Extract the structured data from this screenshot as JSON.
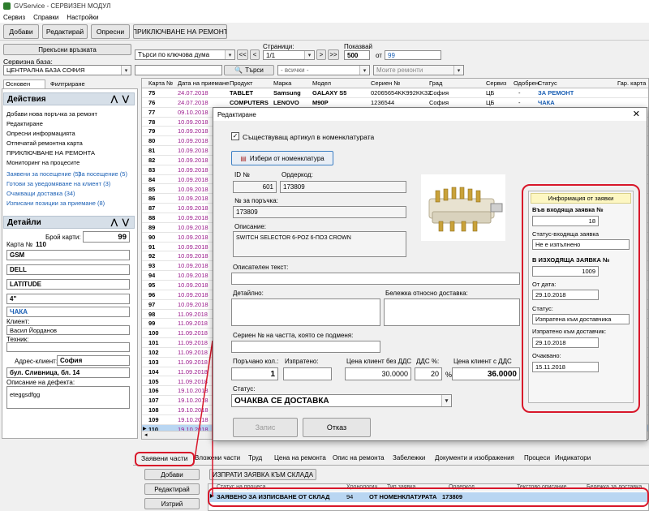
{
  "window_title": "GVService - СЕРВИЗЕН МОДУЛ",
  "menu": [
    "Сервиз",
    "Справки",
    "Настройки"
  ],
  "toolbar": {
    "add": "Добави",
    "edit": "Редактирай",
    "refresh": "Опресни",
    "close_repair": "ПРИКЛЮЧВАНЕ НА РЕМОНТ"
  },
  "connection": {
    "disconnect": "Прекъсни връзката",
    "db_label": "Сервизна база:",
    "db_value": "ЦЕНТРАЛНА БАЗА СОФИЯ"
  },
  "search": {
    "mode": "Търси по ключова дума",
    "pages_label": "Страници:",
    "page_value": "1/1",
    "shown_label": "Показвай",
    "shown_value": "500",
    "of_label": "от",
    "total_value": "99",
    "nav_first": "<<",
    "nav_prev": "<",
    "nav_next": ">",
    "nav_last": ">>",
    "search_button": "Търси",
    "filter_all": "- всички -",
    "my_repairs": "Моите ремонти"
  },
  "left_tabs": {
    "main": "Основен панел",
    "filter": "Филтриране"
  },
  "actions": {
    "title": "Действия",
    "items": [
      "Добави нова поръчка за ремонт",
      "Редактиране",
      "Опресни информацията",
      "Отпечатай ремонтна карта",
      "ПРИКЛЮЧВАНЕ НА РЕМОНТА",
      "Мониторинг на процесите"
    ],
    "links": [
      "Заявени за посещение (5)",
      "За посещение (5)",
      "Готови за уведомяване на клиент (3)",
      "Очакващи доставка (34)",
      "Изписани позиции за приемане (8)"
    ]
  },
  "details": {
    "title": "Детайли",
    "cards_label": "Брой карти:",
    "cards_value": "99",
    "card_label": "Карта №",
    "card_no": "110",
    "type": "GSM",
    "brand": "DELL",
    "model": "LATITUDE",
    "size": "4\"",
    "blank": "",
    "status": "ЧАКА",
    "client_label": "Клиент:",
    "client": "Васил Йорданов",
    "tech_label": "Техник:",
    "tech": "",
    "address_label": "Адрес-клиент:",
    "address_city": "София",
    "address": "бул. Сливница, бл. 14",
    "defect_label": "Описание на дефекта:",
    "defect": "eteggsdfgg"
  },
  "grid": {
    "headers": [
      "Карта №",
      "Дата на приемане",
      "Продукт",
      "Марка",
      "Модел",
      "Сериен №",
      "Град",
      "Сервиз",
      "Одобрен",
      "Статус",
      "Гар. карта"
    ],
    "rows": [
      {
        "no": "75",
        "date": "24.07.2018",
        "product": "TABLET",
        "brand": "Samsung",
        "model": "GALAXY S5",
        "serial": "02065654KK992KK32",
        "city": "София",
        "service": "ЦБ",
        "approved": "-",
        "status": "ЗА РЕМОНТ"
      },
      {
        "no": "76",
        "date": "24.07.2018",
        "product": "COMPUTERS",
        "brand": "LENOVO",
        "model": "M90P",
        "serial": "1236544",
        "city": "София",
        "service": "ЦБ",
        "approved": "-",
        "status": "ЧАКА"
      },
      {
        "no": "77",
        "date": "09.10.2018"
      },
      {
        "no": "78",
        "date": "10.09.2018"
      },
      {
        "no": "79",
        "date": "10.09.2018"
      },
      {
        "no": "80",
        "date": "10.09.2018"
      },
      {
        "no": "81",
        "date": "10.09.2018"
      },
      {
        "no": "82",
        "date": "10.09.2018"
      },
      {
        "no": "83",
        "date": "10.09.2018"
      },
      {
        "no": "84",
        "date": "10.09.2018"
      },
      {
        "no": "85",
        "date": "10.09.2018"
      },
      {
        "no": "86",
        "date": "10.09.2018"
      },
      {
        "no": "87",
        "date": "10.09.2018"
      },
      {
        "no": "88",
        "date": "10.09.2018"
      },
      {
        "no": "89",
        "date": "10.09.2018"
      },
      {
        "no": "90",
        "date": "10.09.2018"
      },
      {
        "no": "91",
        "date": "10.09.2018"
      },
      {
        "no": "92",
        "date": "10.09.2018"
      },
      {
        "no": "93",
        "date": "10.09.2018"
      },
      {
        "no": "94",
        "date": "10.09.2018"
      },
      {
        "no": "95",
        "date": "10.09.2018"
      },
      {
        "no": "96",
        "date": "10.09.2018"
      },
      {
        "no": "97",
        "date": "10.09.2018"
      },
      {
        "no": "98",
        "date": "11.09.2018"
      },
      {
        "no": "99",
        "date": "11.09.2018"
      },
      {
        "no": "100",
        "date": "11.09.2018"
      },
      {
        "no": "101",
        "date": "11.09.2018"
      },
      {
        "no": "102",
        "date": "11.09.2018"
      },
      {
        "no": "103",
        "date": "11.09.2018"
      },
      {
        "no": "104",
        "date": "11.09.2018"
      },
      {
        "no": "105",
        "date": "11.09.2018"
      },
      {
        "no": "106",
        "date": "19.10.2018"
      },
      {
        "no": "107",
        "date": "19.10.2018"
      },
      {
        "no": "108",
        "date": "19.10.2018"
      },
      {
        "no": "109",
        "date": "19.10.2018"
      },
      {
        "no": "110",
        "date": "19.10.2018"
      }
    ]
  },
  "bottom_tabs": [
    "Заявени части",
    "Вложени части",
    "Труд",
    "Цена на ремонта",
    "Опис на ремонта",
    "Забележки",
    "Документи и изображения",
    "Процеси",
    "Индикатори"
  ],
  "parts": {
    "add": "Добави",
    "edit": "Редактирай",
    "delete": "Изтрий",
    "request_button": "ИЗПРАТИ ЗАЯВКА КЪМ СКЛАДА",
    "headers": [
      "Статус на процеса",
      "Хронологич.",
      "Тип заявка",
      "Ордеркод",
      "Текстово описание",
      "Бележка за доставка"
    ],
    "row": {
      "status": "ЗАЯВЕНО ЗА ИЗПИСВАНЕ ОТ СКЛАД",
      "chrono": "94",
      "type": "ОТ НОМЕНКЛАТУРАТА",
      "ordercode": "173809"
    }
  },
  "dialog": {
    "title": "Редактиране",
    "existing_article": "Съществуващ артикул в номенклатурата",
    "choose_button": "Избери от номенклатура",
    "id_label": "ID №",
    "id_value": "601",
    "ordercode_label": "Ордеркод:",
    "ordercode_value": "173809",
    "order_no_label": "№ за поръчка:",
    "order_no_value": "173809",
    "desc_label": "Описание:",
    "desc_value": "SWITCH SELECTOR 6-POZ  6-ПОЗ  CROWN",
    "desc_text_label": "Описателен текст:",
    "desc_text_value": "",
    "detailed_label": "Детайлно:",
    "delivery_note_label": "Бележка относно доставка:",
    "serial_label": "Сериен № на частта, която се подменя:",
    "serial_value": "",
    "ordered_qty_label": "Поръчано кол.:",
    "ordered_qty": "1",
    "sent_label": "Изпратено:",
    "sent_value": "",
    "price_no_vat_label": "Цена клиент без ДДС",
    "price_no_vat": "30.0000",
    "vat_label": "ДДС %:",
    "vat_value": "20",
    "vat_unit": "%",
    "price_vat_label": "Цена клиент с ДДС",
    "price_vat": "36.0000",
    "status_label": "Статус:",
    "status_value": "ОЧАКВА СЕ ДОСТАВКА",
    "save": "Запис",
    "cancel": "Отказ",
    "info": {
      "title": "Информация от заявки",
      "incoming_label": "Във входяща заявка №",
      "incoming_value": "18",
      "incoming_status_label": "Статус-входяща заявка",
      "incoming_status": "Не е изпълнено",
      "outgoing_label": "В ИЗХОДЯЩА ЗАЯВКА №",
      "outgoing_value": "1009",
      "from_date_label": "От дата:",
      "from_date": "29.10.2018",
      "status_label": "Статус:",
      "status_value": "Изпратена към доставчика",
      "sent_date_label": "Изпратено към доставчик:",
      "sent_date": "29.10.2018",
      "expected_label": "Очаквано:",
      "expected_date": "15.11.2018"
    }
  },
  "colors": {
    "accent_red": "#d8172a",
    "link_blue": "#1a5fb4",
    "date_magenta": "#9b1a8c",
    "selected_row": "#b9d6f2"
  }
}
